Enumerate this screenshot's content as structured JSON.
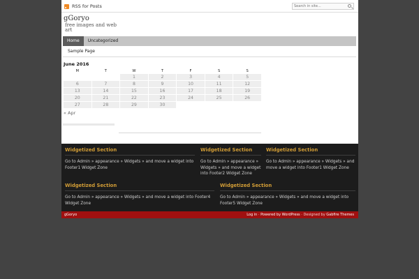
{
  "topbar": {
    "rss_label": "RSS for Posts",
    "search_placeholder": "Search in site..."
  },
  "header": {
    "title": "gGoryo",
    "description": "free images and web art"
  },
  "nav": {
    "items": [
      {
        "label": "Home",
        "active": true
      },
      {
        "label": "Uncategorized",
        "active": false
      }
    ],
    "subitems": [
      "Sample Page"
    ]
  },
  "calendar": {
    "caption": "June 2016",
    "weekdays": [
      "M",
      "T",
      "W",
      "T",
      "F",
      "S",
      "S"
    ],
    "weeks": [
      [
        "",
        "",
        "1",
        "2",
        "3",
        "4",
        "5"
      ],
      [
        "6",
        "7",
        "8",
        "9",
        "10",
        "11",
        "12"
      ],
      [
        "13",
        "14",
        "15",
        "16",
        "17",
        "18",
        "19"
      ],
      [
        "20",
        "21",
        "22",
        "23",
        "24",
        "25",
        "26"
      ],
      [
        "27",
        "28",
        "29",
        "30",
        "",
        "",
        ""
      ]
    ],
    "prev_link": "« Apr"
  },
  "footer": {
    "widgets": [
      {
        "title": "Widgetized Section",
        "text": "Go to Admin » appearance » Widgets » and move a widget into Footer1 Widget Zone"
      },
      {
        "title": "Widgetized Section",
        "text": "Go to Admin » appearance » Widgets » and move a widget into Footer2 Widget Zone"
      },
      {
        "title": "Widgetized Section",
        "text": "Go to Admin » appearance » Widgets » and move a widget into Footer1 Widget Zone"
      },
      {
        "title": "Widgetized Section",
        "text": "Go to Admin » appearance » Widgets » and move a widget into Footer4 Widget Zone"
      },
      {
        "title": "Widgetized Section",
        "text": "Go to Admin » appearance » Widgets » and move a widget into Footer5 Widget Zone"
      }
    ]
  },
  "bottombar": {
    "site_name": "gGoryo",
    "login": "Log in",
    "sep1": " · ",
    "powered_prefix": "Powered by ",
    "wordpress": "WordPress",
    "designed_prefix": " · Designed by ",
    "designer": "Gabfire Themes"
  },
  "colors": {
    "background": "#434343",
    "footer": "#1c1c1c",
    "accent": "#d29d36",
    "bottombar": "#a01010"
  }
}
